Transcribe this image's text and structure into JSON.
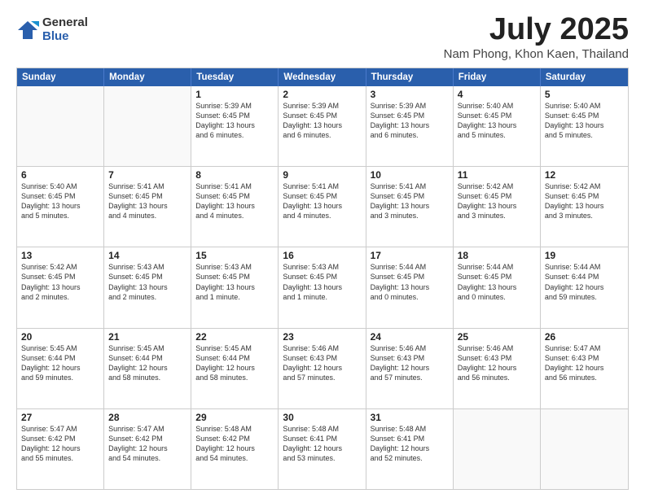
{
  "logo": {
    "general": "General",
    "blue": "Blue"
  },
  "title": "July 2025",
  "location": "Nam Phong, Khon Kaen, Thailand",
  "weekdays": [
    "Sunday",
    "Monday",
    "Tuesday",
    "Wednesday",
    "Thursday",
    "Friday",
    "Saturday"
  ],
  "weeks": [
    [
      {
        "day": "",
        "lines": []
      },
      {
        "day": "",
        "lines": []
      },
      {
        "day": "1",
        "lines": [
          "Sunrise: 5:39 AM",
          "Sunset: 6:45 PM",
          "Daylight: 13 hours",
          "and 6 minutes."
        ]
      },
      {
        "day": "2",
        "lines": [
          "Sunrise: 5:39 AM",
          "Sunset: 6:45 PM",
          "Daylight: 13 hours",
          "and 6 minutes."
        ]
      },
      {
        "day": "3",
        "lines": [
          "Sunrise: 5:39 AM",
          "Sunset: 6:45 PM",
          "Daylight: 13 hours",
          "and 6 minutes."
        ]
      },
      {
        "day": "4",
        "lines": [
          "Sunrise: 5:40 AM",
          "Sunset: 6:45 PM",
          "Daylight: 13 hours",
          "and 5 minutes."
        ]
      },
      {
        "day": "5",
        "lines": [
          "Sunrise: 5:40 AM",
          "Sunset: 6:45 PM",
          "Daylight: 13 hours",
          "and 5 minutes."
        ]
      }
    ],
    [
      {
        "day": "6",
        "lines": [
          "Sunrise: 5:40 AM",
          "Sunset: 6:45 PM",
          "Daylight: 13 hours",
          "and 5 minutes."
        ]
      },
      {
        "day": "7",
        "lines": [
          "Sunrise: 5:41 AM",
          "Sunset: 6:45 PM",
          "Daylight: 13 hours",
          "and 4 minutes."
        ]
      },
      {
        "day": "8",
        "lines": [
          "Sunrise: 5:41 AM",
          "Sunset: 6:45 PM",
          "Daylight: 13 hours",
          "and 4 minutes."
        ]
      },
      {
        "day": "9",
        "lines": [
          "Sunrise: 5:41 AM",
          "Sunset: 6:45 PM",
          "Daylight: 13 hours",
          "and 4 minutes."
        ]
      },
      {
        "day": "10",
        "lines": [
          "Sunrise: 5:41 AM",
          "Sunset: 6:45 PM",
          "Daylight: 13 hours",
          "and 3 minutes."
        ]
      },
      {
        "day": "11",
        "lines": [
          "Sunrise: 5:42 AM",
          "Sunset: 6:45 PM",
          "Daylight: 13 hours",
          "and 3 minutes."
        ]
      },
      {
        "day": "12",
        "lines": [
          "Sunrise: 5:42 AM",
          "Sunset: 6:45 PM",
          "Daylight: 13 hours",
          "and 3 minutes."
        ]
      }
    ],
    [
      {
        "day": "13",
        "lines": [
          "Sunrise: 5:42 AM",
          "Sunset: 6:45 PM",
          "Daylight: 13 hours",
          "and 2 minutes."
        ]
      },
      {
        "day": "14",
        "lines": [
          "Sunrise: 5:43 AM",
          "Sunset: 6:45 PM",
          "Daylight: 13 hours",
          "and 2 minutes."
        ]
      },
      {
        "day": "15",
        "lines": [
          "Sunrise: 5:43 AM",
          "Sunset: 6:45 PM",
          "Daylight: 13 hours",
          "and 1 minute."
        ]
      },
      {
        "day": "16",
        "lines": [
          "Sunrise: 5:43 AM",
          "Sunset: 6:45 PM",
          "Daylight: 13 hours",
          "and 1 minute."
        ]
      },
      {
        "day": "17",
        "lines": [
          "Sunrise: 5:44 AM",
          "Sunset: 6:45 PM",
          "Daylight: 13 hours",
          "and 0 minutes."
        ]
      },
      {
        "day": "18",
        "lines": [
          "Sunrise: 5:44 AM",
          "Sunset: 6:45 PM",
          "Daylight: 13 hours",
          "and 0 minutes."
        ]
      },
      {
        "day": "19",
        "lines": [
          "Sunrise: 5:44 AM",
          "Sunset: 6:44 PM",
          "Daylight: 12 hours",
          "and 59 minutes."
        ]
      }
    ],
    [
      {
        "day": "20",
        "lines": [
          "Sunrise: 5:45 AM",
          "Sunset: 6:44 PM",
          "Daylight: 12 hours",
          "and 59 minutes."
        ]
      },
      {
        "day": "21",
        "lines": [
          "Sunrise: 5:45 AM",
          "Sunset: 6:44 PM",
          "Daylight: 12 hours",
          "and 58 minutes."
        ]
      },
      {
        "day": "22",
        "lines": [
          "Sunrise: 5:45 AM",
          "Sunset: 6:44 PM",
          "Daylight: 12 hours",
          "and 58 minutes."
        ]
      },
      {
        "day": "23",
        "lines": [
          "Sunrise: 5:46 AM",
          "Sunset: 6:43 PM",
          "Daylight: 12 hours",
          "and 57 minutes."
        ]
      },
      {
        "day": "24",
        "lines": [
          "Sunrise: 5:46 AM",
          "Sunset: 6:43 PM",
          "Daylight: 12 hours",
          "and 57 minutes."
        ]
      },
      {
        "day": "25",
        "lines": [
          "Sunrise: 5:46 AM",
          "Sunset: 6:43 PM",
          "Daylight: 12 hours",
          "and 56 minutes."
        ]
      },
      {
        "day": "26",
        "lines": [
          "Sunrise: 5:47 AM",
          "Sunset: 6:43 PM",
          "Daylight: 12 hours",
          "and 56 minutes."
        ]
      }
    ],
    [
      {
        "day": "27",
        "lines": [
          "Sunrise: 5:47 AM",
          "Sunset: 6:42 PM",
          "Daylight: 12 hours",
          "and 55 minutes."
        ]
      },
      {
        "day": "28",
        "lines": [
          "Sunrise: 5:47 AM",
          "Sunset: 6:42 PM",
          "Daylight: 12 hours",
          "and 54 minutes."
        ]
      },
      {
        "day": "29",
        "lines": [
          "Sunrise: 5:48 AM",
          "Sunset: 6:42 PM",
          "Daylight: 12 hours",
          "and 54 minutes."
        ]
      },
      {
        "day": "30",
        "lines": [
          "Sunrise: 5:48 AM",
          "Sunset: 6:41 PM",
          "Daylight: 12 hours",
          "and 53 minutes."
        ]
      },
      {
        "day": "31",
        "lines": [
          "Sunrise: 5:48 AM",
          "Sunset: 6:41 PM",
          "Daylight: 12 hours",
          "and 52 minutes."
        ]
      },
      {
        "day": "",
        "lines": []
      },
      {
        "day": "",
        "lines": []
      }
    ]
  ]
}
